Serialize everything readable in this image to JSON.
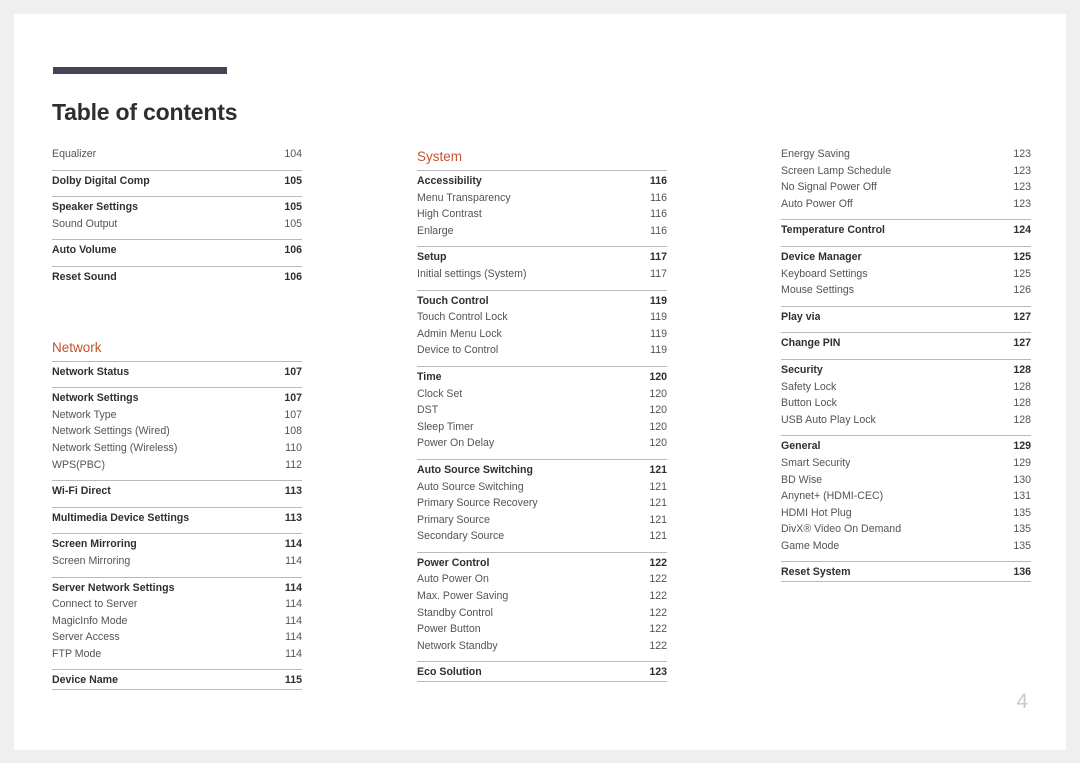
{
  "document": {
    "title": "Table of contents",
    "page_number": "4",
    "accent_color": "#c4532f",
    "rule_color": "#474356"
  },
  "columns": [
    {
      "name": "left",
      "blocks": [
        {
          "type": "group",
          "no_rule": true,
          "rows": [
            {
              "level": 1,
              "label": "Equalizer",
              "page": "104",
              "bold": false
            }
          ]
        },
        {
          "type": "group",
          "rows": [
            {
              "level": 1,
              "label": "Dolby Digital Comp",
              "page": "105",
              "bold": true
            }
          ]
        },
        {
          "type": "group",
          "rows": [
            {
              "level": 1,
              "label": "Speaker Settings",
              "page": "105",
              "bold": true
            },
            {
              "level": 2,
              "label": "Sound Output",
              "page": "105",
              "bold": false
            }
          ]
        },
        {
          "type": "group",
          "rows": [
            {
              "level": 1,
              "label": "Auto Volume",
              "page": "106",
              "bold": true
            }
          ]
        },
        {
          "type": "group",
          "rows": [
            {
              "level": 1,
              "label": "Reset Sound",
              "page": "106",
              "bold": true
            }
          ]
        },
        {
          "type": "section",
          "label": "Network",
          "spaced_top": true
        },
        {
          "type": "group",
          "rows": [
            {
              "level": 1,
              "label": "Network Status",
              "page": "107",
              "bold": true
            }
          ]
        },
        {
          "type": "group",
          "rows": [
            {
              "level": 1,
              "label": "Network Settings",
              "page": "107",
              "bold": true
            },
            {
              "level": 2,
              "label": "Network Type",
              "page": "107",
              "bold": false
            },
            {
              "level": 2,
              "label": "Network Settings (Wired)",
              "page": "108",
              "bold": false
            },
            {
              "level": 2,
              "label": "Network Setting (Wireless)",
              "page": "110",
              "bold": false
            },
            {
              "level": 2,
              "label": "WPS(PBC)",
              "page": "112",
              "bold": false
            }
          ]
        },
        {
          "type": "group",
          "rows": [
            {
              "level": 1,
              "label": "Wi-Fi Direct",
              "page": "113",
              "bold": true
            }
          ]
        },
        {
          "type": "group",
          "rows": [
            {
              "level": 1,
              "label": "Multimedia Device Settings",
              "page": "113",
              "bold": true
            }
          ]
        },
        {
          "type": "group",
          "rows": [
            {
              "level": 1,
              "label": "Screen Mirroring",
              "page": "114",
              "bold": true
            },
            {
              "level": 2,
              "label": "Screen Mirroring",
              "page": "114",
              "bold": false
            }
          ]
        },
        {
          "type": "group",
          "rows": [
            {
              "level": 1,
              "label": "Server Network Settings",
              "page": "114",
              "bold": true
            },
            {
              "level": 2,
              "label": "Connect to Server",
              "page": "114",
              "bold": false
            },
            {
              "level": 2,
              "label": "MagicInfo Mode",
              "page": "114",
              "bold": false
            },
            {
              "level": 2,
              "label": "Server Access",
              "page": "114",
              "bold": false
            },
            {
              "level": 2,
              "label": "FTP Mode",
              "page": "114",
              "bold": false
            }
          ]
        },
        {
          "type": "group",
          "rows": [
            {
              "level": 1,
              "label": "Device Name",
              "page": "115",
              "bold": true
            }
          ]
        }
      ]
    },
    {
      "name": "middle",
      "blocks": [
        {
          "type": "section",
          "label": "System",
          "spaced_top": false
        },
        {
          "type": "group",
          "rows": [
            {
              "level": 1,
              "label": "Accessibility",
              "page": "116",
              "bold": true
            },
            {
              "level": 2,
              "label": "Menu Transparency",
              "page": "116",
              "bold": false
            },
            {
              "level": 2,
              "label": "High Contrast",
              "page": "116",
              "bold": false
            },
            {
              "level": 2,
              "label": "Enlarge",
              "page": "116",
              "bold": false
            }
          ]
        },
        {
          "type": "group",
          "rows": [
            {
              "level": 1,
              "label": "Setup",
              "page": "117",
              "bold": true
            },
            {
              "level": 2,
              "label": "Initial settings (System)",
              "page": "117",
              "bold": false
            }
          ]
        },
        {
          "type": "group",
          "rows": [
            {
              "level": 1,
              "label": "Touch Control",
              "page": "119",
              "bold": true
            },
            {
              "level": 2,
              "label": "Touch Control Lock",
              "page": "119",
              "bold": false
            },
            {
              "level": 2,
              "label": "Admin Menu Lock",
              "page": "119",
              "bold": false
            },
            {
              "level": 2,
              "label": "Device to Control",
              "page": "119",
              "bold": false
            }
          ]
        },
        {
          "type": "group",
          "rows": [
            {
              "level": 1,
              "label": "Time",
              "page": "120",
              "bold": true
            },
            {
              "level": 2,
              "label": "Clock Set",
              "page": "120",
              "bold": false
            },
            {
              "level": 2,
              "label": "DST",
              "page": "120",
              "bold": false
            },
            {
              "level": 2,
              "label": "Sleep Timer",
              "page": "120",
              "bold": false
            },
            {
              "level": 2,
              "label": "Power On Delay",
              "page": "120",
              "bold": false
            }
          ]
        },
        {
          "type": "group",
          "rows": [
            {
              "level": 1,
              "label": "Auto Source Switching",
              "page": "121",
              "bold": true
            },
            {
              "level": 2,
              "label": "Auto Source Switching",
              "page": "121",
              "bold": false
            },
            {
              "level": 2,
              "label": "Primary Source Recovery",
              "page": "121",
              "bold": false
            },
            {
              "level": 2,
              "label": "Primary Source",
              "page": "121",
              "bold": false
            },
            {
              "level": 2,
              "label": "Secondary Source",
              "page": "121",
              "bold": false
            }
          ]
        },
        {
          "type": "group",
          "rows": [
            {
              "level": 1,
              "label": "Power Control",
              "page": "122",
              "bold": true
            },
            {
              "level": 2,
              "label": "Auto Power On",
              "page": "122",
              "bold": false
            },
            {
              "level": 2,
              "label": "Max. Power Saving",
              "page": "122",
              "bold": false
            },
            {
              "level": 2,
              "label": "Standby Control",
              "page": "122",
              "bold": false
            },
            {
              "level": 2,
              "label": "Power Button",
              "page": "122",
              "bold": false
            },
            {
              "level": 2,
              "label": "Network Standby",
              "page": "122",
              "bold": false
            }
          ]
        },
        {
          "type": "group",
          "rows": [
            {
              "level": 1,
              "label": "Eco Solution",
              "page": "123",
              "bold": true
            }
          ]
        }
      ]
    },
    {
      "name": "right",
      "blocks": [
        {
          "type": "group",
          "no_rule": true,
          "rows": [
            {
              "level": 2,
              "label": "Energy Saving",
              "page": "123",
              "bold": false
            },
            {
              "level": 2,
              "label": "Screen Lamp Schedule",
              "page": "123",
              "bold": false
            },
            {
              "level": 2,
              "label": "No Signal Power Off",
              "page": "123",
              "bold": false
            },
            {
              "level": 2,
              "label": "Auto Power Off",
              "page": "123",
              "bold": false
            }
          ]
        },
        {
          "type": "group",
          "rows": [
            {
              "level": 1,
              "label": "Temperature Control",
              "page": "124",
              "bold": true
            }
          ]
        },
        {
          "type": "group",
          "rows": [
            {
              "level": 1,
              "label": "Device Manager",
              "page": "125",
              "bold": true
            },
            {
              "level": 2,
              "label": "Keyboard Settings",
              "page": "125",
              "bold": false
            },
            {
              "level": 2,
              "label": "Mouse Settings",
              "page": "126",
              "bold": false
            }
          ]
        },
        {
          "type": "group",
          "rows": [
            {
              "level": 1,
              "label": "Play via",
              "page": "127",
              "bold": true
            }
          ]
        },
        {
          "type": "group",
          "rows": [
            {
              "level": 1,
              "label": "Change PIN",
              "page": "127",
              "bold": true
            }
          ]
        },
        {
          "type": "group",
          "rows": [
            {
              "level": 1,
              "label": "Security",
              "page": "128",
              "bold": true
            },
            {
              "level": 2,
              "label": "Safety Lock",
              "page": "128",
              "bold": false
            },
            {
              "level": 2,
              "label": "Button Lock",
              "page": "128",
              "bold": false
            },
            {
              "level": 2,
              "label": "USB Auto Play Lock",
              "page": "128",
              "bold": false
            }
          ]
        },
        {
          "type": "group",
          "rows": [
            {
              "level": 1,
              "label": "General",
              "page": "129",
              "bold": true
            },
            {
              "level": 2,
              "label": "Smart Security",
              "page": "129",
              "bold": false
            },
            {
              "level": 2,
              "label": "BD Wise",
              "page": "130",
              "bold": false
            },
            {
              "level": 2,
              "label": "Anynet+ (HDMI-CEC)",
              "page": "131",
              "bold": false
            },
            {
              "level": 2,
              "label": "HDMI Hot Plug",
              "page": "135",
              "bold": false
            },
            {
              "level": 2,
              "label": "DivX® Video On Demand",
              "page": "135",
              "bold": false
            },
            {
              "level": 2,
              "label": "Game Mode",
              "page": "135",
              "bold": false
            }
          ]
        },
        {
          "type": "group",
          "rows": [
            {
              "level": 1,
              "label": "Reset System",
              "page": "136",
              "bold": true
            }
          ]
        }
      ]
    }
  ]
}
